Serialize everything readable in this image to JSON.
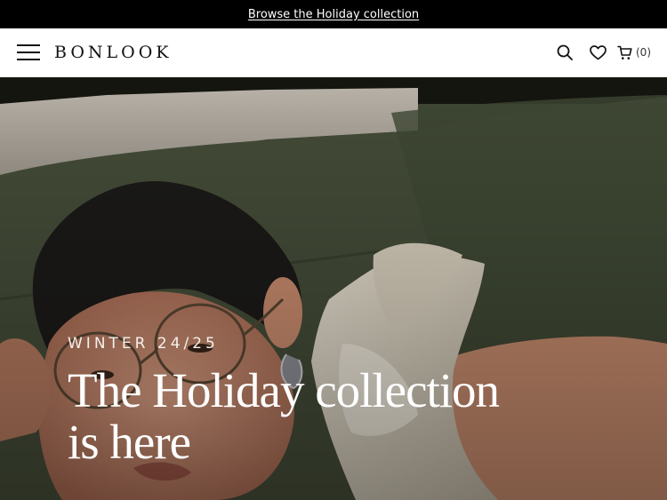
{
  "announcement": {
    "link_text": "Browse the Holiday collection"
  },
  "header": {
    "logo": "BONLOOK",
    "cart_count": "(0)",
    "icons": {
      "menu": "hamburger-icon",
      "search": "search-icon",
      "wishlist": "heart-icon",
      "cart": "cart-icon"
    }
  },
  "hero": {
    "eyebrow": "WINTER 24/25",
    "headline": "The Holiday collection is here"
  },
  "colors": {
    "topbar": "#000000",
    "header_bg": "#ffffff",
    "hero_text": "#ffffff",
    "sofa_green": "#434b37"
  }
}
